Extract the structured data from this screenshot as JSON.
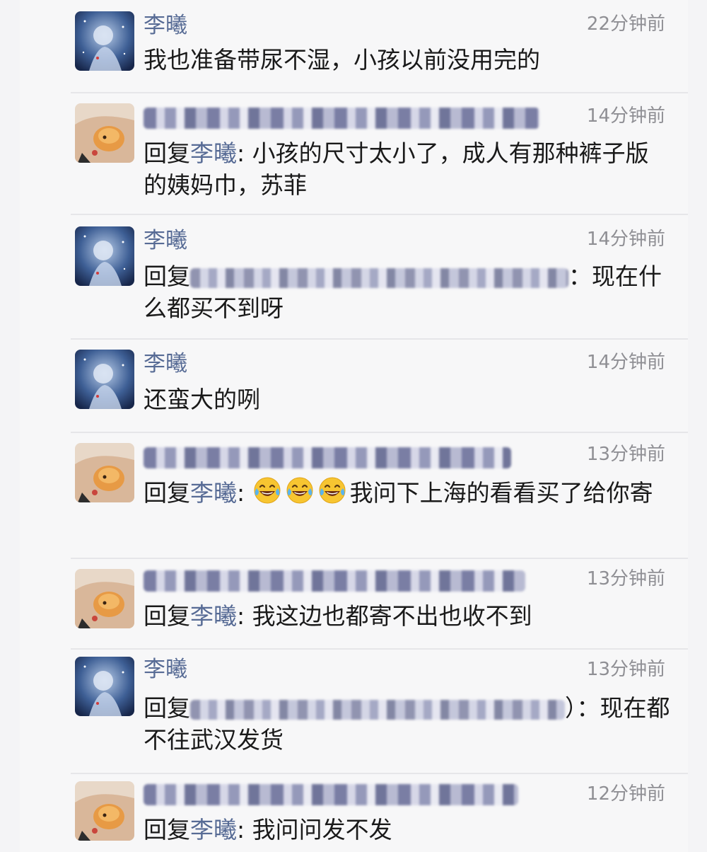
{
  "comments": [
    {
      "author": "李曦",
      "time": "22分钟前",
      "text": "我也准备带尿不湿，小孩以前没用完的"
    },
    {
      "time": "14分钟前",
      "reply_prefix": "回复",
      "reply_target": "李曦",
      "reply_sep": ":",
      "text": "小孩的尺寸太小了，成人有那种裤子版的姨妈巾，苏菲"
    },
    {
      "author": "李曦",
      "time": "14分钟前",
      "reply_prefix": "回复",
      "reply_sep": "：",
      "text": "现在什么都买不到呀"
    },
    {
      "author": "李曦",
      "time": "14分钟前",
      "text": "还蛮大的咧"
    },
    {
      "time": "13分钟前",
      "reply_prefix": "回复",
      "reply_target": "李曦",
      "reply_sep": ":",
      "emoji": [
        "face-with-tears-of-joy",
        "face-with-tears-of-joy",
        "face-with-tears-of-joy"
      ],
      "text": "我问下上海的看看买了给你寄"
    },
    {
      "time": "13分钟前",
      "reply_prefix": "回复",
      "reply_target": "李曦",
      "reply_sep": ":",
      "text": "我这边也都寄不出也收不到"
    },
    {
      "author": "李曦",
      "time": "13分钟前",
      "reply_prefix": "回复",
      "reply_sep": "）：",
      "text": "现在都不往武汉发货"
    },
    {
      "time": "12分钟前",
      "reply_prefix": "回复",
      "reply_target": "李曦",
      "reply_sep": ":",
      "text": "我问问发不发"
    }
  ],
  "colors": {
    "name_link": "#576b95",
    "time_text": "#8f8f94",
    "body_text": "#1a1a1a"
  },
  "icons": {
    "avatar_a": "starry-girl-avatar",
    "avatar_b": "hamster-hand-avatar",
    "emoji": "face-with-tears-of-joy"
  }
}
